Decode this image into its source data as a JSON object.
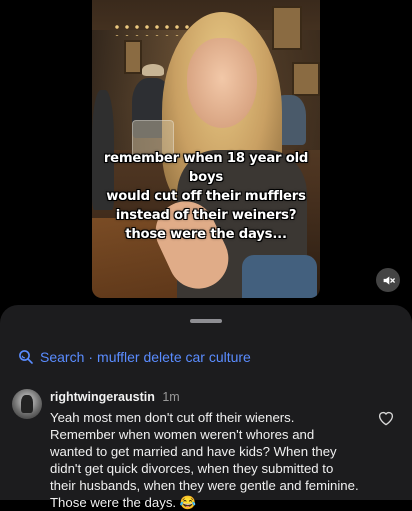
{
  "video": {
    "caption_lines": [
      "remember when 18 year old boys",
      "would cut off their mufflers",
      "instead of their weiners?",
      "those were the days..."
    ],
    "mute_icon": "speaker-muted-icon"
  },
  "sheet": {
    "search": {
      "icon": "search-icon",
      "label": "Search",
      "separator": "·",
      "query": "muffler delete car culture",
      "color": "#5a8cff"
    },
    "comment": {
      "username": "rightwingeraustin",
      "time": "1m",
      "text": "Yeah most men don't cut off their wieners. Remember when women weren't whores and wanted to get married and have kids? When they didn't get quick divorces,  when they submitted to their husbands,  when they were gentle and feminine. Those were the days. 😂",
      "like_icon": "heart-icon"
    }
  }
}
